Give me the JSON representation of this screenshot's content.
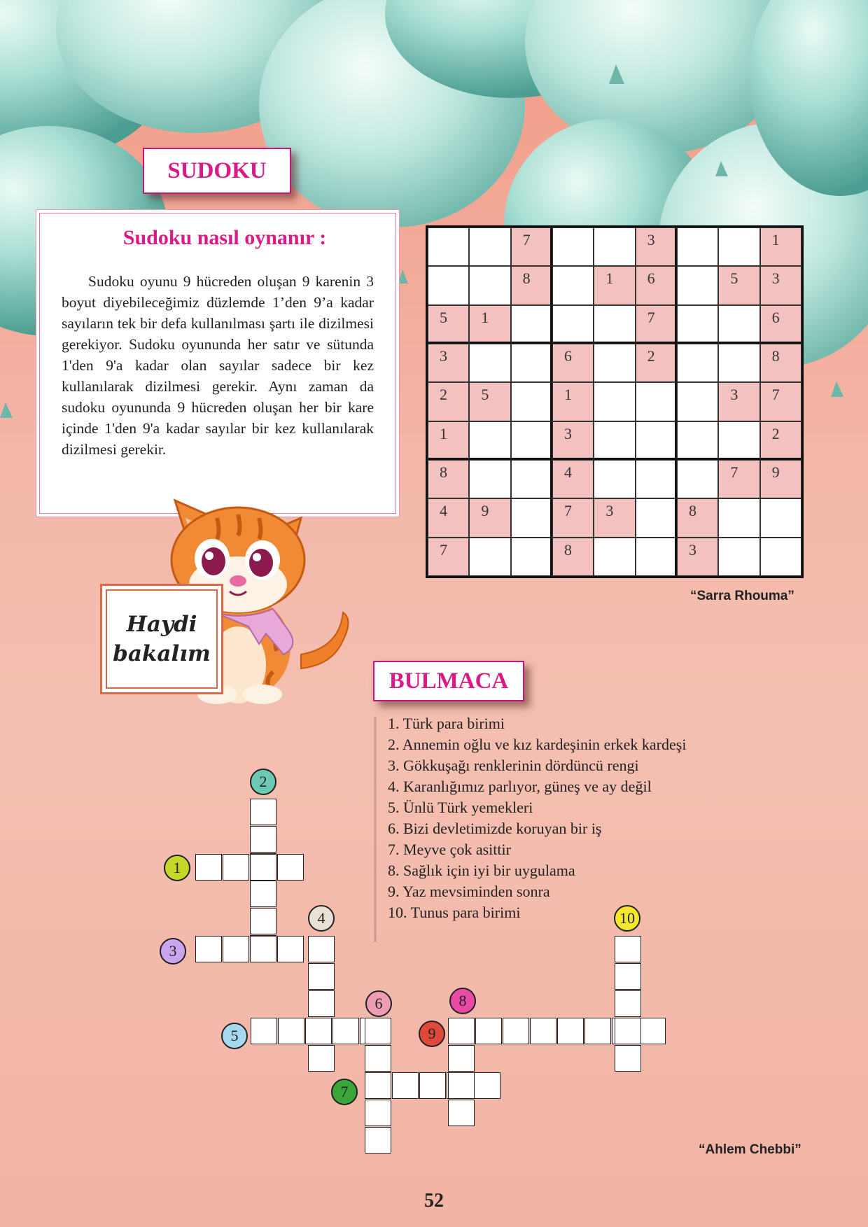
{
  "sudoku_section": {
    "title": "SUDOKU",
    "howto_title": "Sudoku nasıl oynanır :",
    "howto_text": "Sudoku oyunu 9 hücreden oluşan 9 karenin 3 boyut diyebileceğimiz düzlemde 1’den 9’a kadar sayıların tek bir defa kullanılması şartı ile dizilmesi gerekiyor. Sudoku oyununda her satır ve sütunda 1'den 9'a kadar olan sayılar sadece bir kez kullanılarak dizilmesi gerekir. Aynı zaman da sudoku oyununda 9 hücreden oluşan her bir kare içinde 1'den 9'a kadar sayılar bir kez kullanılarak dizilmesi gerekir.",
    "grid": [
      [
        "",
        "",
        "7",
        "",
        "",
        "3",
        "",
        "",
        "1"
      ],
      [
        "",
        "",
        "8",
        "",
        "1",
        "6",
        "",
        "5",
        "3"
      ],
      [
        "5",
        "1",
        "",
        "",
        "",
        "7",
        "",
        "",
        "6"
      ],
      [
        "3",
        "",
        "",
        "6",
        "",
        "2",
        "",
        "",
        "8"
      ],
      [
        "2",
        "5",
        "",
        "1",
        "",
        "",
        "",
        "3",
        "7"
      ],
      [
        "1",
        "",
        "",
        "3",
        "",
        "",
        "",
        "",
        "2"
      ],
      [
        "8",
        "",
        "",
        "4",
        "",
        "",
        "",
        "7",
        "9"
      ],
      [
        "4",
        "9",
        "",
        "7",
        "3",
        "",
        "8",
        "",
        ""
      ],
      [
        "7",
        "",
        "",
        "8",
        "",
        "",
        "3",
        "",
        ""
      ]
    ],
    "credit": "“Sarra Rhouma”"
  },
  "sign": {
    "line1": "Haydi",
    "line2": "bakalım"
  },
  "bulmaca_section": {
    "title": "BULMACA",
    "clues": [
      "1. Türk para birimi",
      "2. Annemin oğlu ve kız kardeşinin erkek kardeşi",
      "3. Gökkuşağı renklerinin dördüncü rengi",
      "4. Karanlığımız parlıyor, güneş ve ay değil",
      "5. Ünlü Türk yemekleri",
      "6. Bizi devletimizde koruyan bir iş",
      "7. Meyve çok asittir",
      "8. Sağlık için iyi bir uygulama",
      "9. Yaz mevsiminden sonra",
      "10. Tunus para birimi"
    ],
    "numbers": [
      "1",
      "2",
      "3",
      "4",
      "5",
      "6",
      "7",
      "8",
      "9",
      "10"
    ],
    "number_colors": [
      "#c5d82a",
      "#6cc9b4",
      "#c9a6ef",
      "#e8e2d6",
      "#a6d9ef",
      "#ee9cb4",
      "#3aa63a",
      "#e94aa6",
      "#e0483a",
      "#f4e62a"
    ],
    "credit": "“Ahlem Chebbi”"
  },
  "page_number": "52",
  "colors": {
    "accent_magenta": "#d81b88",
    "sudoku_given_fill": "#f2c1c0",
    "background_peach": "#f3b7a8",
    "balloon_teal": "#8fd4c7"
  }
}
